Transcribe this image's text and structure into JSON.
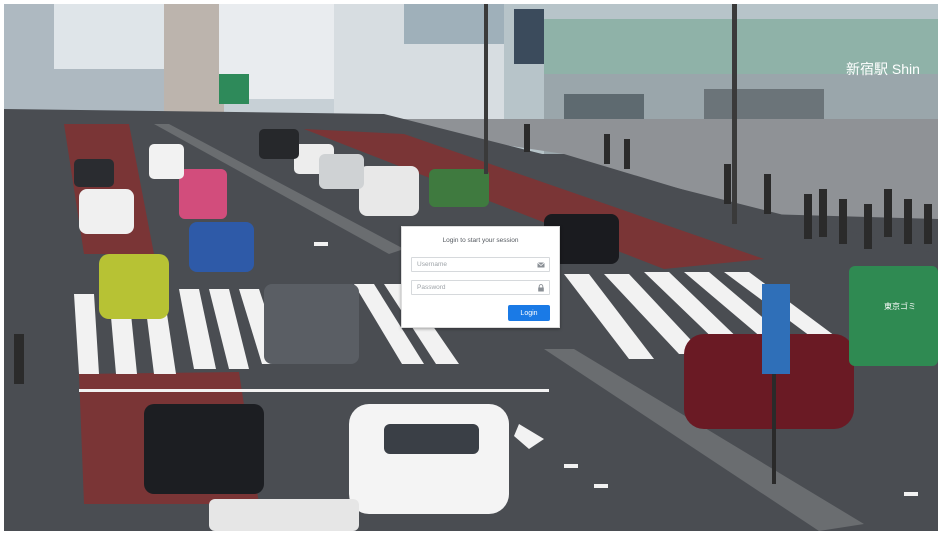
{
  "background": {
    "description_icon": "photo-background",
    "store_sign": "新宿駅 Shin",
    "truck_sign": "東京ゴミ",
    "colors": {
      "road": "#4a4d52",
      "bus_lane": "#7a3536",
      "crosswalk": "#f2f2f2",
      "building": "#c9d2d8",
      "truck": "#2f8a52"
    }
  },
  "login": {
    "title": "Login to start your session",
    "username_placeholder": "Username",
    "password_placeholder": "Password",
    "username_icon": "envelope-icon",
    "password_icon": "lock-icon",
    "button_label": "Login",
    "button_color": "#1a7ae6"
  }
}
